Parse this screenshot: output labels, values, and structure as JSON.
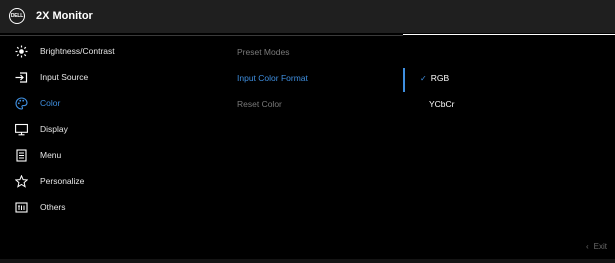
{
  "header": {
    "logo_text": "DELL",
    "title": "2X Monitor"
  },
  "menu": [
    {
      "label": "Brightness/Contrast",
      "icon": "brightness-icon",
      "active": false
    },
    {
      "label": "Input Source",
      "icon": "input-source-icon",
      "active": false
    },
    {
      "label": "Color",
      "icon": "color-palette-icon",
      "active": true
    },
    {
      "label": "Display",
      "icon": "display-icon",
      "active": false
    },
    {
      "label": "Menu",
      "icon": "menu-icon",
      "active": false
    },
    {
      "label": "Personalize",
      "icon": "star-icon",
      "active": false
    },
    {
      "label": "Others",
      "icon": "others-icon",
      "active": false
    }
  ],
  "submenu": [
    {
      "label": "Preset Modes",
      "active": false
    },
    {
      "label": "Input Color Format",
      "active": true
    },
    {
      "label": "Reset Color",
      "active": false
    }
  ],
  "options": [
    {
      "label": "RGB",
      "selected": true
    },
    {
      "label": "YCbCr",
      "selected": false
    }
  ],
  "footer": {
    "exit_label": "Exit"
  },
  "colors": {
    "accent": "#3f8fe0",
    "background": "#000000",
    "header": "#1f1f1f"
  }
}
